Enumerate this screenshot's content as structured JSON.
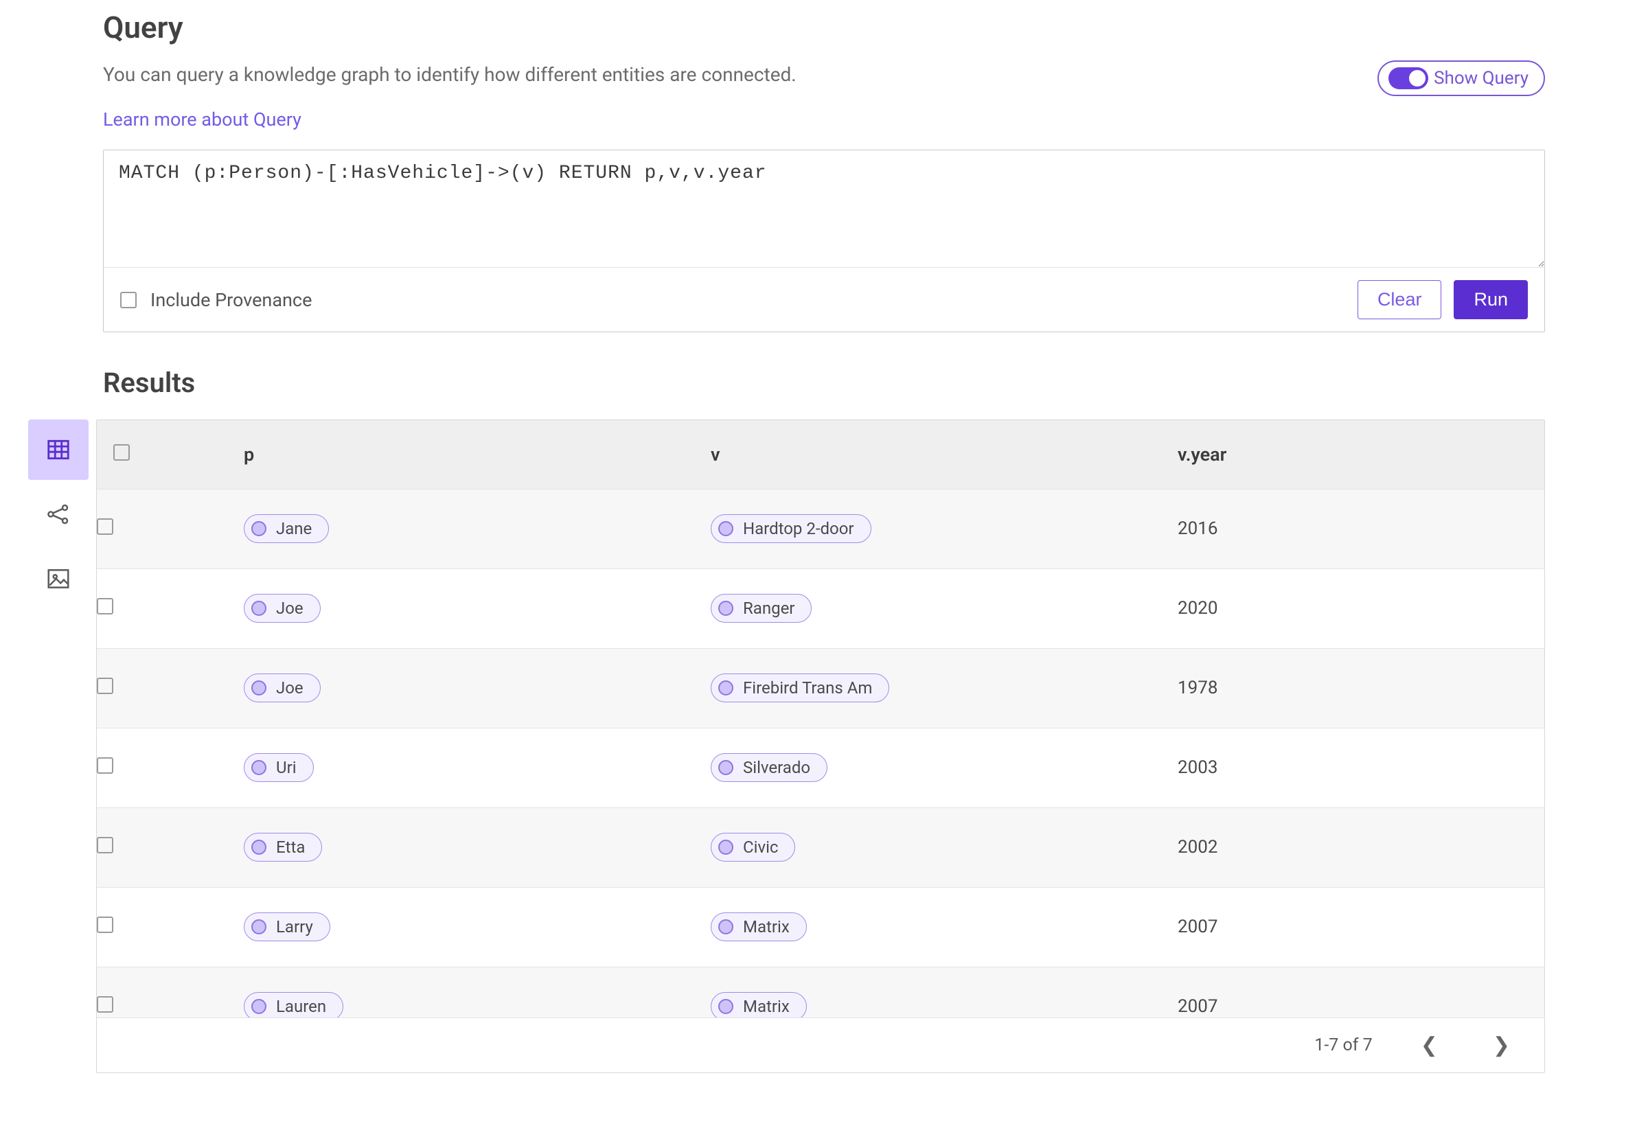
{
  "header": {
    "title": "Query",
    "intro": "You can query a knowledge graph to identify how different entities are connected.",
    "learn_link": "Learn more about Query"
  },
  "show_query": {
    "label": "Show Query",
    "on": true
  },
  "query_box": {
    "value": "MATCH (p:Person)-[:HasVehicle]->(v) RETURN p,v,v.year",
    "include_provenance_label": "Include Provenance",
    "include_provenance_checked": false,
    "clear_label": "Clear",
    "run_label": "Run"
  },
  "results": {
    "title": "Results",
    "columns": {
      "p": "p",
      "v": "v",
      "year": "v.year"
    },
    "rows": [
      {
        "p": "Jane",
        "v": "Hardtop 2-door",
        "year": "2016"
      },
      {
        "p": "Joe",
        "v": "Ranger",
        "year": "2020"
      },
      {
        "p": "Joe",
        "v": "Firebird Trans Am",
        "year": "1978"
      },
      {
        "p": "Uri",
        "v": "Silverado",
        "year": "2003"
      },
      {
        "p": "Etta",
        "v": "Civic",
        "year": "2002"
      },
      {
        "p": "Larry",
        "v": "Matrix",
        "year": "2007"
      },
      {
        "p": "Lauren",
        "v": "Matrix",
        "year": "2007"
      }
    ],
    "pager": {
      "range": "1-7 of 7"
    }
  },
  "view_switcher": {
    "table": "table-view",
    "graph": "graph-view",
    "image": "image-view"
  }
}
